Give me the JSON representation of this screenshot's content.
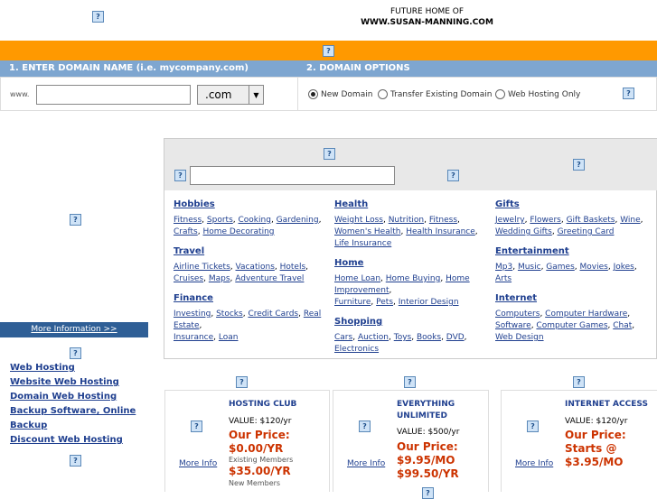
{
  "header": {
    "line1": "FUTURE HOME OF",
    "line2": "WWW.SUSAN-MANNING.COM"
  },
  "icons": {
    "help": "?"
  },
  "step1": {
    "label": "1. ENTER DOMAIN NAME (i.e. mycompany.com)",
    "prefix": "www.",
    "domain_value": "",
    "tld_selected": ".com"
  },
  "step2": {
    "label": "2. DOMAIN OPTIONS",
    "options": [
      "New Domain",
      "Transfer Existing Domain",
      "Web Hosting Only"
    ],
    "selected": "New Domain"
  },
  "categories": {
    "search_value": "",
    "col1": [
      {
        "title": "Hobbies",
        "links": [
          "Fitness",
          "Sports",
          "Cooking",
          "Gardening",
          "Crafts",
          "Home Decorating"
        ]
      },
      {
        "title": "Travel",
        "links": [
          "Airline Tickets",
          "Vacations",
          "Hotels",
          "Cruises",
          "Maps",
          "Adventure Travel"
        ]
      },
      {
        "title": "Finance",
        "links": [
          "Investing",
          "Stocks",
          "Credit Cards",
          "Real Estate",
          "Insurance",
          "Loan"
        ]
      }
    ],
    "col2": [
      {
        "title": "Health",
        "links": [
          "Weight Loss",
          "Nutrition",
          "Fitness",
          "Women's Health",
          "Health Insurance",
          "Life Insurance"
        ]
      },
      {
        "title": "Home",
        "links": [
          "Home Loan",
          "Home Buying",
          "Home Improvement",
          "Furniture",
          "Pets",
          "Interior Design"
        ]
      },
      {
        "title": "Shopping",
        "links": [
          "Cars",
          "Auction",
          "Toys",
          "Books",
          "DVD",
          "Electronics"
        ]
      }
    ],
    "col3": [
      {
        "title": "Gifts",
        "links": [
          "Jewelry",
          "Flowers",
          "Gift Baskets",
          "Wine",
          "Wedding Gifts",
          "Greeting Card"
        ]
      },
      {
        "title": "Entertainment",
        "links": [
          "Mp3",
          "Music",
          "Games",
          "Movies",
          "Jokes",
          "Arts"
        ]
      },
      {
        "title": "Internet",
        "links": [
          "Computers",
          "Computer Hardware",
          "Software",
          "Computer Games",
          "Chat",
          "Web Design"
        ]
      }
    ]
  },
  "sidebar": {
    "more_info": "More Information >>",
    "links": [
      "Web Hosting",
      "Website Web Hosting",
      "Domain Web Hosting",
      "Backup Software, Online Backup",
      "Discount Web Hosting"
    ]
  },
  "products": [
    {
      "title": "HOSTING CLUB",
      "value": "VALUE: $120/yr",
      "price_label": "Our Price:",
      "price": "$0.00/YR",
      "note1": "Existing Members",
      "price2": "$35.00/YR",
      "note2": "New Members",
      "more": "More Info"
    },
    {
      "title": "EVERYTHING UNLIMITED",
      "value": "VALUE: $500/yr",
      "price_label": "Our Price:",
      "price": "$9.95/MO",
      "price2": "$99.50/YR",
      "more": "More Info"
    },
    {
      "title": "INTERNET ACCESS",
      "value": "VALUE: $120/yr",
      "price_label": "Our Price:",
      "price": "Starts @",
      "price2": "$3.95/MO",
      "more": "More Info"
    }
  ],
  "colors": {
    "orange_bar": "#ff9900",
    "step_bar": "#7ea6d0",
    "link": "#1f3f8f",
    "price": "#cc3300",
    "more_info_bg": "#2f5f96"
  }
}
